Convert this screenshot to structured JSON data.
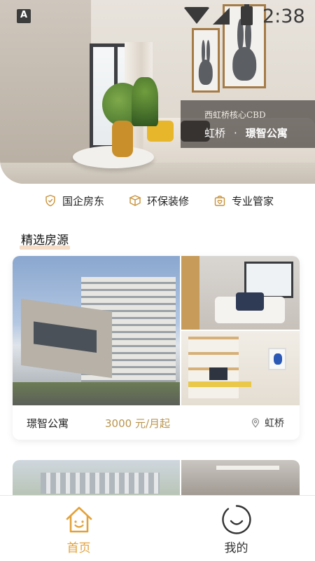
{
  "status_bar": {
    "time": "2:38",
    "icons": [
      "a-notification-icon",
      "wifi-icon",
      "signal-icon",
      "battery-charging-icon"
    ]
  },
  "hero": {
    "subtitle": "西虹桥核心CBD",
    "district": "虹桥",
    "separator": "·",
    "project": "璟智公寓"
  },
  "features": [
    {
      "icon": "shield-icon",
      "label": "国企房东"
    },
    {
      "icon": "box-icon",
      "label": "环保装修"
    },
    {
      "icon": "butler-icon",
      "label": "专业管家"
    }
  ],
  "section": {
    "title": "精选房源",
    "highlight_color": "#f4dcc6"
  },
  "listings": [
    {
      "name": "璟智公寓",
      "price": "3000 元/月起",
      "location": "虹桥"
    }
  ],
  "tabbar": {
    "items": [
      {
        "icon": "home-icon",
        "label": "首页",
        "active": true
      },
      {
        "icon": "smile-icon",
        "label": "我的",
        "active": false
      }
    ]
  },
  "colors": {
    "accent": "#e2a23b",
    "price": "#b9944c"
  }
}
